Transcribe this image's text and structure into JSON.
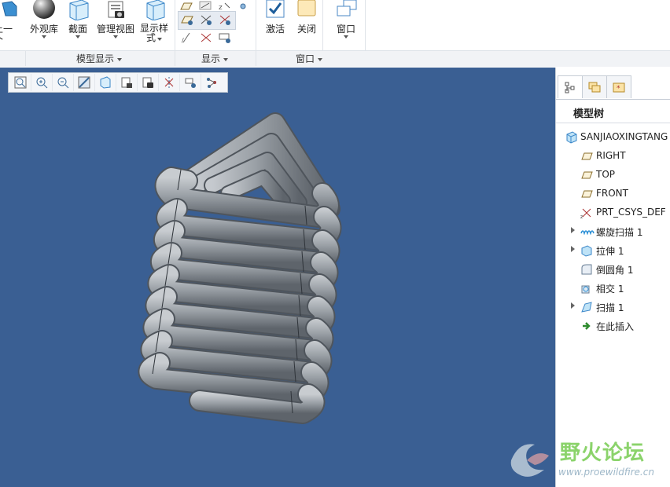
{
  "ribbon": {
    "buttons": [
      {
        "label": "上一个",
        "icon": "previous-view-icon"
      },
      {
        "label": "外观库",
        "icon": "appearance-sphere-icon"
      },
      {
        "label": "截面",
        "icon": "section-box-icon"
      },
      {
        "label": "管理视图",
        "icon": "manage-views-icon"
      },
      {
        "label": "显示样式",
        "icon": "display-style-icon"
      },
      {
        "label": "激活",
        "icon": "activate-check-icon"
      },
      {
        "label": "关闭",
        "icon": "close-window-icon"
      },
      {
        "label": "窗口",
        "icon": "windows-icon"
      }
    ],
    "groups": {
      "model_display": "模型显示",
      "display": "显示",
      "window": "窗口"
    },
    "previous_label_top": "上一",
    "previous_label_bottom": "个",
    "display_style_top": "显示样",
    "display_style_bottom": "式"
  },
  "view_toolbar": {
    "tools": [
      "refit-icon",
      "zoom-in-icon",
      "zoom-out-icon",
      "repaint-icon",
      "orientation-icon",
      "saved-views-icon",
      "display-style-icon",
      "datum-display-icon",
      "spin-center-icon",
      "annotation-display-icon"
    ]
  },
  "panel": {
    "title": "模型树",
    "tabs": [
      "model-tree-tab-icon",
      "layer-tree-tab-icon",
      "favorites-tab-icon"
    ],
    "tree": [
      {
        "label": "SANJIAOXINGTANG",
        "icon": "part-icon",
        "expandable": false,
        "level": 0
      },
      {
        "label": "RIGHT",
        "icon": "datum-plane-icon",
        "expandable": false,
        "level": 1
      },
      {
        "label": "TOP",
        "icon": "datum-plane-icon",
        "expandable": false,
        "level": 1
      },
      {
        "label": "FRONT",
        "icon": "datum-plane-icon",
        "expandable": false,
        "level": 1
      },
      {
        "label": "PRT_CSYS_DEF",
        "icon": "csys-icon",
        "expandable": false,
        "level": 1
      },
      {
        "label": "螺旋扫描 1",
        "icon": "helical-sweep-icon",
        "expandable": true,
        "level": 1
      },
      {
        "label": "拉伸 1",
        "icon": "extrude-icon",
        "expandable": true,
        "level": 1
      },
      {
        "label": "倒圆角 1",
        "icon": "round-icon",
        "expandable": false,
        "level": 1
      },
      {
        "label": "相交 1",
        "icon": "intersect-icon",
        "expandable": false,
        "level": 1
      },
      {
        "label": "扫描 1",
        "icon": "sweep-icon",
        "expandable": true,
        "level": 1
      },
      {
        "label": "在此插入",
        "icon": "insert-here-arrow-icon",
        "expandable": false,
        "level": 1
      }
    ]
  },
  "watermark": {
    "title": "野火论坛",
    "url": "www.proewildfire.cn"
  },
  "colors": {
    "viewport_bg": "#3a5f93",
    "tube": "#9aa0a6",
    "insert_arrow": "#2e8b2e",
    "watermark_green": "#8bd36b"
  }
}
